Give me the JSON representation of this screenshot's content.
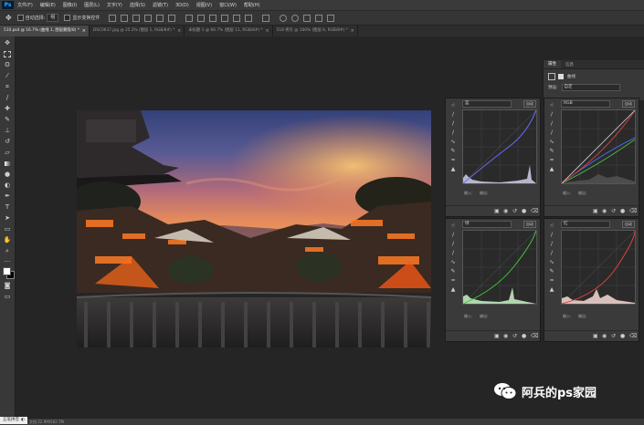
{
  "app": {
    "logo": "Ps"
  },
  "menubar": {
    "items": [
      "文件(F)",
      "编辑(E)",
      "图像(I)",
      "图层(L)",
      "文字(Y)",
      "选择(S)",
      "滤镜(T)",
      "3D(D)",
      "视图(V)",
      "窗口(W)",
      "帮助(H)"
    ]
  },
  "options": {
    "auto_select_label": "自动选择:",
    "auto_select_value": "组",
    "show_transform_label": "显示变换控件"
  },
  "tabs": [
    {
      "label": "510.psd @ 16.7% (曲线 1, 图层蒙版/8) *",
      "active": true
    },
    {
      "label": "DSC0637.jpg @ 25.2% (图层 1, RGB/8#) *",
      "active": false
    },
    {
      "label": "未标题-1 @ 66.7% (图层 11, RGB/8#) *",
      "active": false
    },
    {
      "label": "518 拷贝 @ 100% (图层 6, RGB/8#) *",
      "active": false
    }
  ],
  "properties": {
    "tab_active": "属性",
    "tab_2": "信息",
    "adjust_name": "曲线",
    "preset_label": "预设:",
    "preset_value": "自定"
  },
  "curves": [
    {
      "channel": "蓝",
      "auto": "自动",
      "input": "输入:",
      "output": "输出:",
      "color": "#6a6aff"
    },
    {
      "channel": "RGB",
      "auto": "自动",
      "input": "输入:",
      "output": "输出:",
      "color": "#9a9a9a"
    },
    {
      "channel": "绿",
      "auto": "自动",
      "input": "输入:",
      "output": "输出:",
      "color": "#3ec43e"
    },
    {
      "channel": "红",
      "auto": "自动",
      "input": "输入:",
      "output": "输出:",
      "color": "#e04040"
    }
  ],
  "status": {
    "zoom": "16.67%",
    "doc": "文档:22.9M/562.7M"
  },
  "ime": {
    "label": "五笔拼音"
  },
  "watermark": {
    "text": "阿兵的ps家园"
  },
  "icons": {
    "tools": [
      "move-icon",
      "marquee-icon",
      "lasso-icon",
      "magic-wand-icon",
      "crop-icon",
      "eyedropper-icon",
      "healing-icon",
      "brush-icon",
      "stamp-icon",
      "history-brush-icon",
      "eraser-icon",
      "gradient-icon",
      "blur-icon",
      "dodge-icon",
      "pen-icon",
      "type-icon",
      "path-select-icon",
      "shape-icon",
      "hand-icon",
      "zoom-icon"
    ]
  }
}
